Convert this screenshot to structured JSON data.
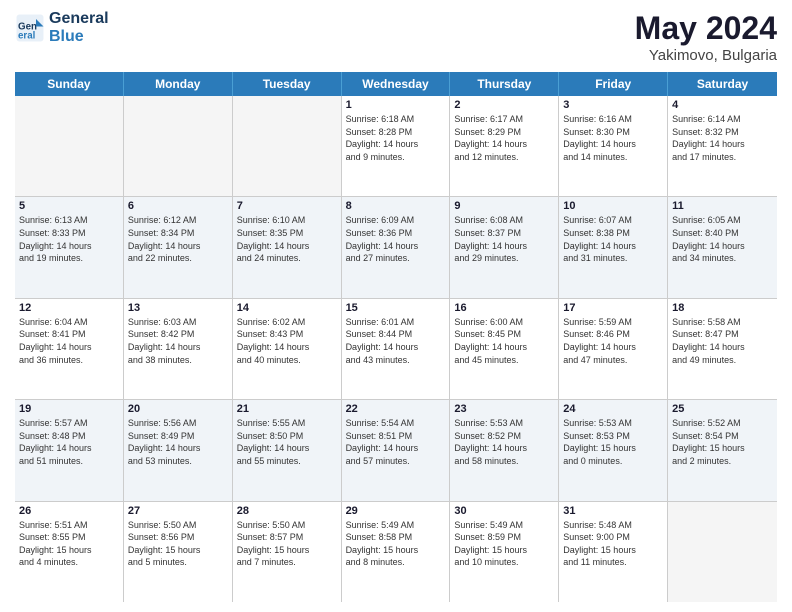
{
  "header": {
    "logo_general": "General",
    "logo_blue": "Blue",
    "month": "May 2024",
    "location": "Yakimovo, Bulgaria"
  },
  "weekdays": [
    "Sunday",
    "Monday",
    "Tuesday",
    "Wednesday",
    "Thursday",
    "Friday",
    "Saturday"
  ],
  "rows": [
    [
      {
        "day": "",
        "text": ""
      },
      {
        "day": "",
        "text": ""
      },
      {
        "day": "",
        "text": ""
      },
      {
        "day": "1",
        "text": "Sunrise: 6:18 AM\nSunset: 8:28 PM\nDaylight: 14 hours\nand 9 minutes."
      },
      {
        "day": "2",
        "text": "Sunrise: 6:17 AM\nSunset: 8:29 PM\nDaylight: 14 hours\nand 12 minutes."
      },
      {
        "day": "3",
        "text": "Sunrise: 6:16 AM\nSunset: 8:30 PM\nDaylight: 14 hours\nand 14 minutes."
      },
      {
        "day": "4",
        "text": "Sunrise: 6:14 AM\nSunset: 8:32 PM\nDaylight: 14 hours\nand 17 minutes."
      }
    ],
    [
      {
        "day": "5",
        "text": "Sunrise: 6:13 AM\nSunset: 8:33 PM\nDaylight: 14 hours\nand 19 minutes."
      },
      {
        "day": "6",
        "text": "Sunrise: 6:12 AM\nSunset: 8:34 PM\nDaylight: 14 hours\nand 22 minutes."
      },
      {
        "day": "7",
        "text": "Sunrise: 6:10 AM\nSunset: 8:35 PM\nDaylight: 14 hours\nand 24 minutes."
      },
      {
        "day": "8",
        "text": "Sunrise: 6:09 AM\nSunset: 8:36 PM\nDaylight: 14 hours\nand 27 minutes."
      },
      {
        "day": "9",
        "text": "Sunrise: 6:08 AM\nSunset: 8:37 PM\nDaylight: 14 hours\nand 29 minutes."
      },
      {
        "day": "10",
        "text": "Sunrise: 6:07 AM\nSunset: 8:38 PM\nDaylight: 14 hours\nand 31 minutes."
      },
      {
        "day": "11",
        "text": "Sunrise: 6:05 AM\nSunset: 8:40 PM\nDaylight: 14 hours\nand 34 minutes."
      }
    ],
    [
      {
        "day": "12",
        "text": "Sunrise: 6:04 AM\nSunset: 8:41 PM\nDaylight: 14 hours\nand 36 minutes."
      },
      {
        "day": "13",
        "text": "Sunrise: 6:03 AM\nSunset: 8:42 PM\nDaylight: 14 hours\nand 38 minutes."
      },
      {
        "day": "14",
        "text": "Sunrise: 6:02 AM\nSunset: 8:43 PM\nDaylight: 14 hours\nand 40 minutes."
      },
      {
        "day": "15",
        "text": "Sunrise: 6:01 AM\nSunset: 8:44 PM\nDaylight: 14 hours\nand 43 minutes."
      },
      {
        "day": "16",
        "text": "Sunrise: 6:00 AM\nSunset: 8:45 PM\nDaylight: 14 hours\nand 45 minutes."
      },
      {
        "day": "17",
        "text": "Sunrise: 5:59 AM\nSunset: 8:46 PM\nDaylight: 14 hours\nand 47 minutes."
      },
      {
        "day": "18",
        "text": "Sunrise: 5:58 AM\nSunset: 8:47 PM\nDaylight: 14 hours\nand 49 minutes."
      }
    ],
    [
      {
        "day": "19",
        "text": "Sunrise: 5:57 AM\nSunset: 8:48 PM\nDaylight: 14 hours\nand 51 minutes."
      },
      {
        "day": "20",
        "text": "Sunrise: 5:56 AM\nSunset: 8:49 PM\nDaylight: 14 hours\nand 53 minutes."
      },
      {
        "day": "21",
        "text": "Sunrise: 5:55 AM\nSunset: 8:50 PM\nDaylight: 14 hours\nand 55 minutes."
      },
      {
        "day": "22",
        "text": "Sunrise: 5:54 AM\nSunset: 8:51 PM\nDaylight: 14 hours\nand 57 minutes."
      },
      {
        "day": "23",
        "text": "Sunrise: 5:53 AM\nSunset: 8:52 PM\nDaylight: 14 hours\nand 58 minutes."
      },
      {
        "day": "24",
        "text": "Sunrise: 5:53 AM\nSunset: 8:53 PM\nDaylight: 15 hours\nand 0 minutes."
      },
      {
        "day": "25",
        "text": "Sunrise: 5:52 AM\nSunset: 8:54 PM\nDaylight: 15 hours\nand 2 minutes."
      }
    ],
    [
      {
        "day": "26",
        "text": "Sunrise: 5:51 AM\nSunset: 8:55 PM\nDaylight: 15 hours\nand 4 minutes."
      },
      {
        "day": "27",
        "text": "Sunrise: 5:50 AM\nSunset: 8:56 PM\nDaylight: 15 hours\nand 5 minutes."
      },
      {
        "day": "28",
        "text": "Sunrise: 5:50 AM\nSunset: 8:57 PM\nDaylight: 15 hours\nand 7 minutes."
      },
      {
        "day": "29",
        "text": "Sunrise: 5:49 AM\nSunset: 8:58 PM\nDaylight: 15 hours\nand 8 minutes."
      },
      {
        "day": "30",
        "text": "Sunrise: 5:49 AM\nSunset: 8:59 PM\nDaylight: 15 hours\nand 10 minutes."
      },
      {
        "day": "31",
        "text": "Sunrise: 5:48 AM\nSunset: 9:00 PM\nDaylight: 15 hours\nand 11 minutes."
      },
      {
        "day": "",
        "text": ""
      }
    ]
  ]
}
